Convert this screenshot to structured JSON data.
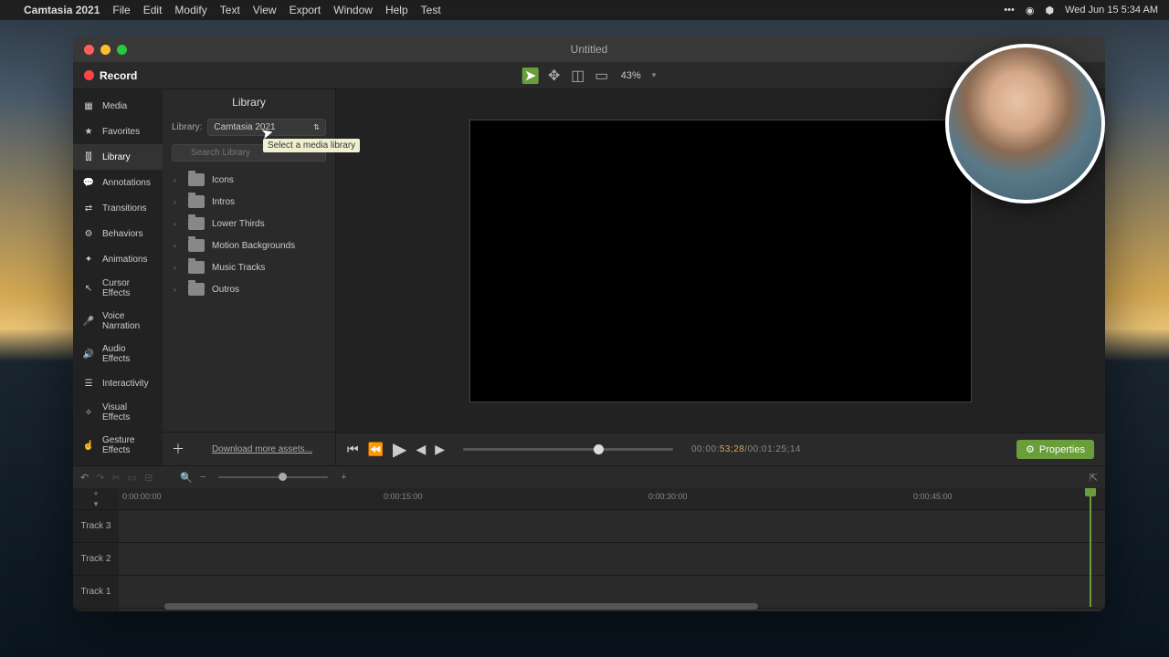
{
  "menubar": {
    "app": "Camtasia 2021",
    "items": [
      "File",
      "Edit",
      "Modify",
      "Text",
      "View",
      "Export",
      "Window",
      "Help",
      "Test"
    ],
    "datetime": "Wed Jun 15 5:34 AM"
  },
  "window": {
    "title": "Untitled",
    "record": "Record",
    "zoom_pct": "43%"
  },
  "sidebar": {
    "items": [
      {
        "label": "Media"
      },
      {
        "label": "Favorites"
      },
      {
        "label": "Library"
      },
      {
        "label": "Annotations"
      },
      {
        "label": "Transitions"
      },
      {
        "label": "Behaviors"
      },
      {
        "label": "Animations"
      },
      {
        "label": "Cursor Effects"
      },
      {
        "label": "Voice Narration"
      },
      {
        "label": "Audio Effects"
      },
      {
        "label": "Interactivity"
      },
      {
        "label": "Visual Effects"
      },
      {
        "label": "Gesture Effects"
      }
    ]
  },
  "library": {
    "header": "Library",
    "label": "Library:",
    "selected": "Camtasia 2021",
    "search_placeholder": "Search Library",
    "tooltip": "Select a media library",
    "folders": [
      "Icons",
      "Intros",
      "Lower Thirds",
      "Motion Backgrounds",
      "Music Tracks",
      "Outros"
    ],
    "download": "Download more assets..."
  },
  "playback": {
    "time_left": "00:00:",
    "time_hl": "53;28",
    "time_right": "/00:01:25;14",
    "properties": "Properties"
  },
  "timeline": {
    "ticks": [
      "0:00:00:00",
      "0:00:15:00",
      "0:00:30:00",
      "0:00:45:00"
    ],
    "tracks": [
      "Track 3",
      "Track 2",
      "Track 1"
    ]
  }
}
